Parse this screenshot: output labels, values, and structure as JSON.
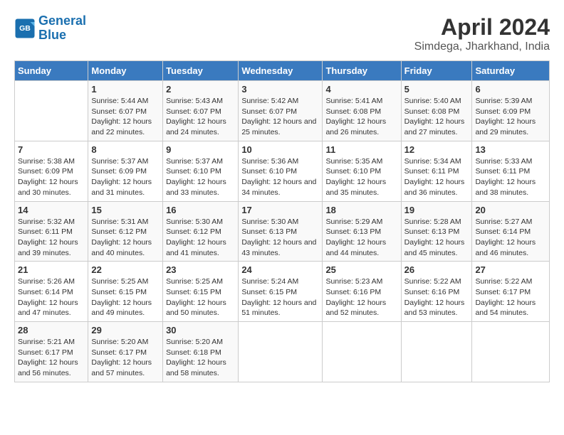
{
  "logo": {
    "line1": "General",
    "line2": "Blue"
  },
  "title": "April 2024",
  "subtitle": "Simdega, Jharkhand, India",
  "days_of_week": [
    "Sunday",
    "Monday",
    "Tuesday",
    "Wednesday",
    "Thursday",
    "Friday",
    "Saturday"
  ],
  "weeks": [
    [
      {
        "day": "",
        "sunrise": "",
        "sunset": "",
        "daylight": ""
      },
      {
        "day": "1",
        "sunrise": "Sunrise: 5:44 AM",
        "sunset": "Sunset: 6:07 PM",
        "daylight": "Daylight: 12 hours and 22 minutes."
      },
      {
        "day": "2",
        "sunrise": "Sunrise: 5:43 AM",
        "sunset": "Sunset: 6:07 PM",
        "daylight": "Daylight: 12 hours and 24 minutes."
      },
      {
        "day": "3",
        "sunrise": "Sunrise: 5:42 AM",
        "sunset": "Sunset: 6:07 PM",
        "daylight": "Daylight: 12 hours and 25 minutes."
      },
      {
        "day": "4",
        "sunrise": "Sunrise: 5:41 AM",
        "sunset": "Sunset: 6:08 PM",
        "daylight": "Daylight: 12 hours and 26 minutes."
      },
      {
        "day": "5",
        "sunrise": "Sunrise: 5:40 AM",
        "sunset": "Sunset: 6:08 PM",
        "daylight": "Daylight: 12 hours and 27 minutes."
      },
      {
        "day": "6",
        "sunrise": "Sunrise: 5:39 AM",
        "sunset": "Sunset: 6:09 PM",
        "daylight": "Daylight: 12 hours and 29 minutes."
      }
    ],
    [
      {
        "day": "7",
        "sunrise": "Sunrise: 5:38 AM",
        "sunset": "Sunset: 6:09 PM",
        "daylight": "Daylight: 12 hours and 30 minutes."
      },
      {
        "day": "8",
        "sunrise": "Sunrise: 5:37 AM",
        "sunset": "Sunset: 6:09 PM",
        "daylight": "Daylight: 12 hours and 31 minutes."
      },
      {
        "day": "9",
        "sunrise": "Sunrise: 5:37 AM",
        "sunset": "Sunset: 6:10 PM",
        "daylight": "Daylight: 12 hours and 33 minutes."
      },
      {
        "day": "10",
        "sunrise": "Sunrise: 5:36 AM",
        "sunset": "Sunset: 6:10 PM",
        "daylight": "Daylight: 12 hours and 34 minutes."
      },
      {
        "day": "11",
        "sunrise": "Sunrise: 5:35 AM",
        "sunset": "Sunset: 6:10 PM",
        "daylight": "Daylight: 12 hours and 35 minutes."
      },
      {
        "day": "12",
        "sunrise": "Sunrise: 5:34 AM",
        "sunset": "Sunset: 6:11 PM",
        "daylight": "Daylight: 12 hours and 36 minutes."
      },
      {
        "day": "13",
        "sunrise": "Sunrise: 5:33 AM",
        "sunset": "Sunset: 6:11 PM",
        "daylight": "Daylight: 12 hours and 38 minutes."
      }
    ],
    [
      {
        "day": "14",
        "sunrise": "Sunrise: 5:32 AM",
        "sunset": "Sunset: 6:11 PM",
        "daylight": "Daylight: 12 hours and 39 minutes."
      },
      {
        "day": "15",
        "sunrise": "Sunrise: 5:31 AM",
        "sunset": "Sunset: 6:12 PM",
        "daylight": "Daylight: 12 hours and 40 minutes."
      },
      {
        "day": "16",
        "sunrise": "Sunrise: 5:30 AM",
        "sunset": "Sunset: 6:12 PM",
        "daylight": "Daylight: 12 hours and 41 minutes."
      },
      {
        "day": "17",
        "sunrise": "Sunrise: 5:30 AM",
        "sunset": "Sunset: 6:13 PM",
        "daylight": "Daylight: 12 hours and 43 minutes."
      },
      {
        "day": "18",
        "sunrise": "Sunrise: 5:29 AM",
        "sunset": "Sunset: 6:13 PM",
        "daylight": "Daylight: 12 hours and 44 minutes."
      },
      {
        "day": "19",
        "sunrise": "Sunrise: 5:28 AM",
        "sunset": "Sunset: 6:13 PM",
        "daylight": "Daylight: 12 hours and 45 minutes."
      },
      {
        "day": "20",
        "sunrise": "Sunrise: 5:27 AM",
        "sunset": "Sunset: 6:14 PM",
        "daylight": "Daylight: 12 hours and 46 minutes."
      }
    ],
    [
      {
        "day": "21",
        "sunrise": "Sunrise: 5:26 AM",
        "sunset": "Sunset: 6:14 PM",
        "daylight": "Daylight: 12 hours and 47 minutes."
      },
      {
        "day": "22",
        "sunrise": "Sunrise: 5:25 AM",
        "sunset": "Sunset: 6:15 PM",
        "daylight": "Daylight: 12 hours and 49 minutes."
      },
      {
        "day": "23",
        "sunrise": "Sunrise: 5:25 AM",
        "sunset": "Sunset: 6:15 PM",
        "daylight": "Daylight: 12 hours and 50 minutes."
      },
      {
        "day": "24",
        "sunrise": "Sunrise: 5:24 AM",
        "sunset": "Sunset: 6:15 PM",
        "daylight": "Daylight: 12 hours and 51 minutes."
      },
      {
        "day": "25",
        "sunrise": "Sunrise: 5:23 AM",
        "sunset": "Sunset: 6:16 PM",
        "daylight": "Daylight: 12 hours and 52 minutes."
      },
      {
        "day": "26",
        "sunrise": "Sunrise: 5:22 AM",
        "sunset": "Sunset: 6:16 PM",
        "daylight": "Daylight: 12 hours and 53 minutes."
      },
      {
        "day": "27",
        "sunrise": "Sunrise: 5:22 AM",
        "sunset": "Sunset: 6:17 PM",
        "daylight": "Daylight: 12 hours and 54 minutes."
      }
    ],
    [
      {
        "day": "28",
        "sunrise": "Sunrise: 5:21 AM",
        "sunset": "Sunset: 6:17 PM",
        "daylight": "Daylight: 12 hours and 56 minutes."
      },
      {
        "day": "29",
        "sunrise": "Sunrise: 5:20 AM",
        "sunset": "Sunset: 6:17 PM",
        "daylight": "Daylight: 12 hours and 57 minutes."
      },
      {
        "day": "30",
        "sunrise": "Sunrise: 5:20 AM",
        "sunset": "Sunset: 6:18 PM",
        "daylight": "Daylight: 12 hours and 58 minutes."
      },
      {
        "day": "",
        "sunrise": "",
        "sunset": "",
        "daylight": ""
      },
      {
        "day": "",
        "sunrise": "",
        "sunset": "",
        "daylight": ""
      },
      {
        "day": "",
        "sunrise": "",
        "sunset": "",
        "daylight": ""
      },
      {
        "day": "",
        "sunrise": "",
        "sunset": "",
        "daylight": ""
      }
    ]
  ]
}
